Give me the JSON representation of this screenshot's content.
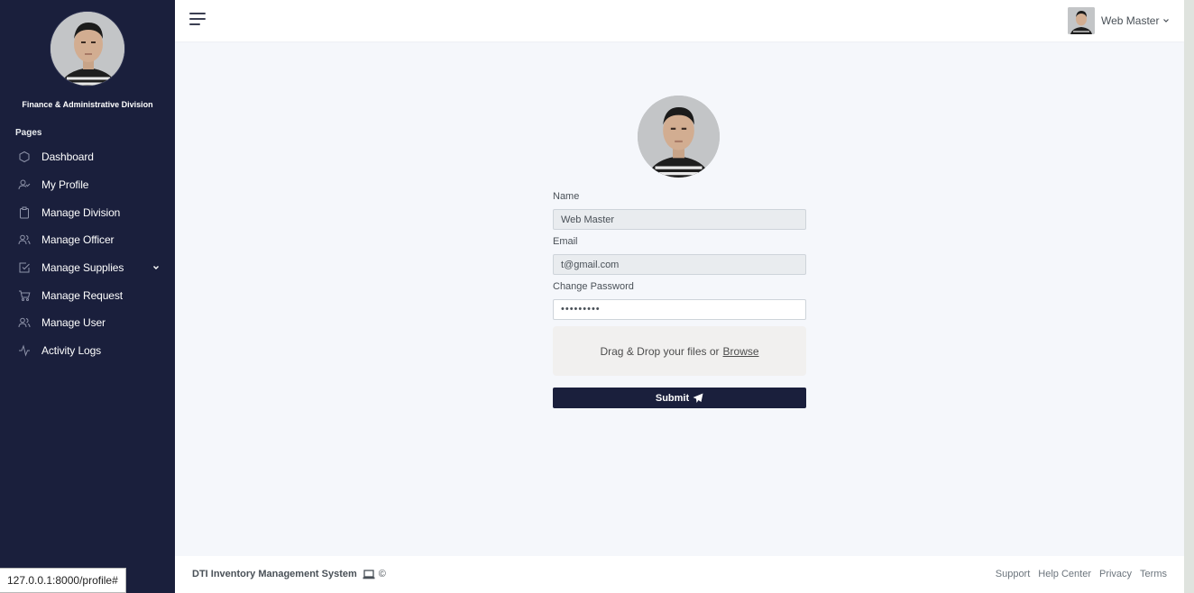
{
  "sidebar": {
    "organization": "Finance & Administrative Division",
    "section_header": "Pages",
    "items": [
      {
        "label": "Dashboard",
        "icon": "hexagon-icon"
      },
      {
        "label": "My Profile",
        "icon": "user-check-icon"
      },
      {
        "label": "Manage Division",
        "icon": "clipboard-icon"
      },
      {
        "label": "Manage Officer",
        "icon": "users-icon"
      },
      {
        "label": "Manage Supplies",
        "icon": "check-square-icon",
        "has_submenu": true
      },
      {
        "label": "Manage Request",
        "icon": "shopping-cart-icon"
      },
      {
        "label": "Manage User",
        "icon": "users-icon"
      },
      {
        "label": "Activity Logs",
        "icon": "activity-icon"
      }
    ]
  },
  "topbar": {
    "user_name": "Web Master"
  },
  "profile_form": {
    "name_label": "Name",
    "name_value": "Web Master",
    "email_label": "Email",
    "email_value": "t@gmail.com",
    "password_label": "Change Password",
    "password_value": "•••••••••",
    "dropzone_text": "Drag & Drop your files or",
    "dropzone_browse": "Browse",
    "submit_label": "Submit"
  },
  "footer": {
    "title": "DTI Inventory Management System",
    "copyright": "©",
    "links": [
      "Support",
      "Help Center",
      "Privacy",
      "Terms"
    ]
  },
  "status_url": "127.0.0.1:8000/profile#",
  "colors": {
    "sidebar_bg": "#1a1f3c",
    "page_bg": "#f5f7fb",
    "button_bg": "#1a1f3c"
  }
}
